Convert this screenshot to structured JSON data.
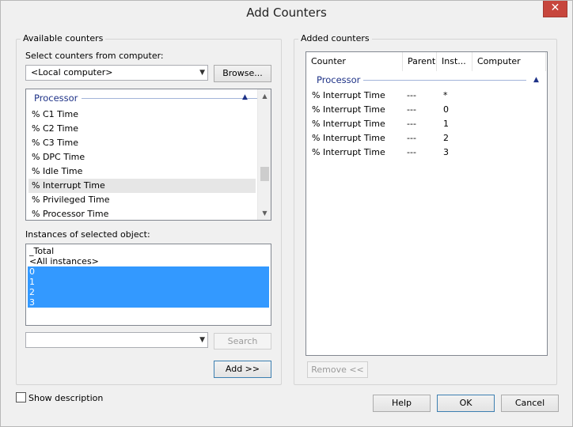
{
  "window": {
    "title": "Add Counters",
    "close_glyph": "✕"
  },
  "available": {
    "group_label": "Available counters",
    "select_label": "Select counters from computer:",
    "computer_value": "<Local computer>",
    "browse_label": "Browse...",
    "category": "Processor",
    "counters": [
      "% C1 Time",
      "% C2 Time",
      "% C3 Time",
      "% DPC Time",
      "% Idle Time",
      "% Interrupt Time",
      "% Privileged Time",
      "% Processor Time"
    ],
    "selected_counter": "% Interrupt Time",
    "instances_label": "Instances of selected object:",
    "instances": [
      "_Total",
      "<All instances>",
      "0",
      "1",
      "2",
      "3"
    ],
    "selected_instances": [
      "0",
      "1",
      "2",
      "3"
    ],
    "search_value": "",
    "search_label": "Search",
    "add_label": "Add >>"
  },
  "added": {
    "group_label": "Added counters",
    "columns": [
      "Counter",
      "Parent",
      "Inst...",
      "Computer"
    ],
    "category": "Processor",
    "rows": [
      {
        "counter": "% Interrupt Time",
        "parent": "---",
        "instance": "*",
        "computer": ""
      },
      {
        "counter": "% Interrupt Time",
        "parent": "---",
        "instance": "0",
        "computer": ""
      },
      {
        "counter": "% Interrupt Time",
        "parent": "---",
        "instance": "1",
        "computer": ""
      },
      {
        "counter": "% Interrupt Time",
        "parent": "---",
        "instance": "2",
        "computer": ""
      },
      {
        "counter": "% Interrupt Time",
        "parent": "---",
        "instance": "3",
        "computer": ""
      }
    ],
    "remove_label": "Remove <<"
  },
  "footer": {
    "show_description_label": "Show description",
    "show_description_checked": false,
    "help_label": "Help",
    "ok_label": "OK",
    "cancel_label": "Cancel"
  },
  "icons": {
    "dropdown": "chevron-down-icon",
    "collapse": "chevron-up-icon",
    "close": "close-icon"
  },
  "colors": {
    "selection": "#3399ff",
    "category_text": "#1e3287",
    "close_button": "#c7463d"
  }
}
